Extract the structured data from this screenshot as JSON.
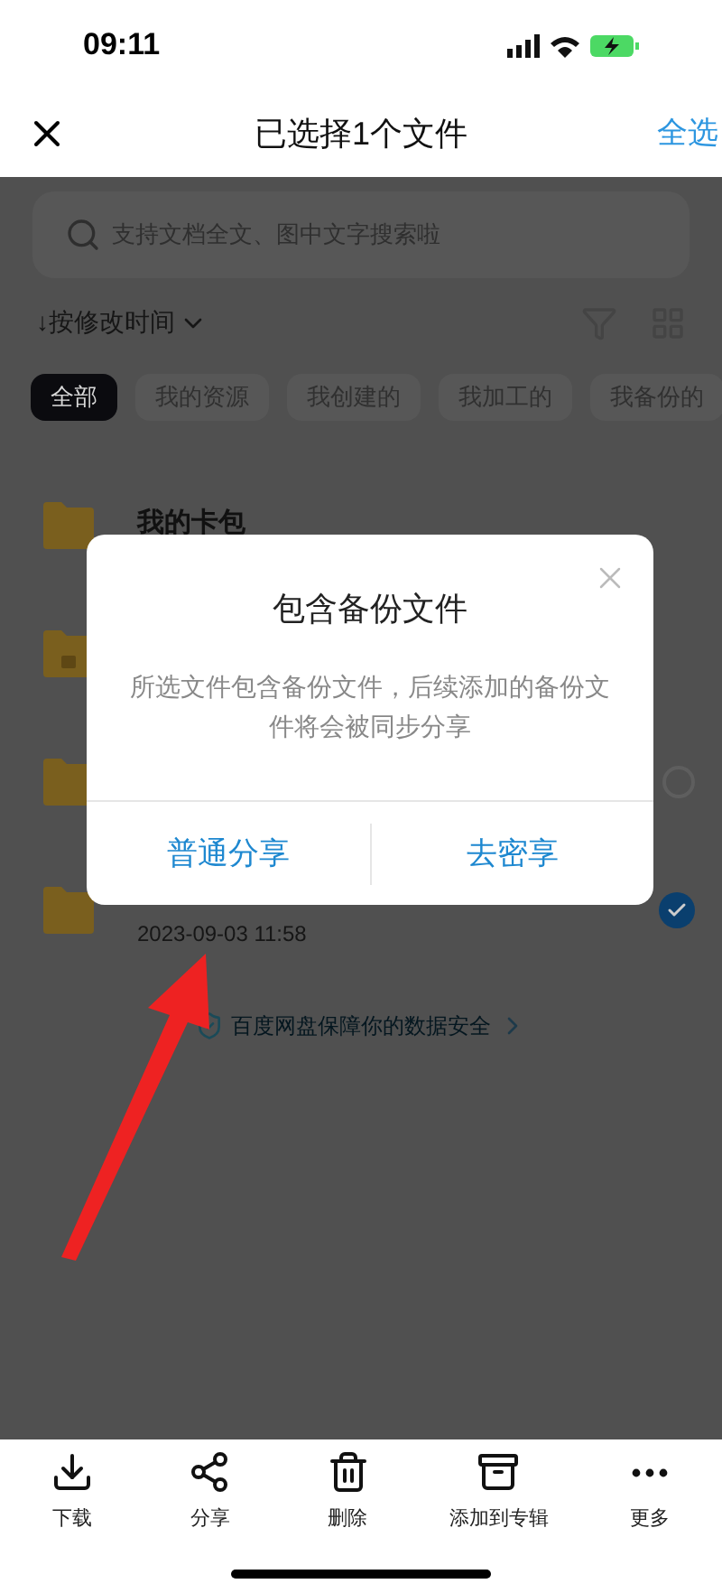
{
  "status_bar": {
    "time": "09:11"
  },
  "header": {
    "title": "已选择1个文件",
    "select_all": "全选"
  },
  "search": {
    "placeholder": "支持文档全文、图中文字搜索啦"
  },
  "sort": {
    "label": "↓按修改时间"
  },
  "chips": [
    {
      "label": "全部",
      "selected": true
    },
    {
      "label": "我的资源",
      "selected": false
    },
    {
      "label": "我创建的",
      "selected": false
    },
    {
      "label": "我加工的",
      "selected": false
    },
    {
      "label": "我备份的",
      "selected": false
    }
  ],
  "files": [
    {
      "name": "我的卡包",
      "locked": false
    },
    {
      "locked": true
    },
    {
      "locked": false,
      "checked": false
    },
    {
      "locked": false,
      "checked": true,
      "date": "2023-09-03 11:58"
    }
  ],
  "security_note": "百度网盘保障你的数据安全",
  "dialog": {
    "title": "包含备份文件",
    "message": "所选文件包含备份文件，后续添加的备份文件将会被同步分享",
    "buttons": [
      "普通分享",
      "去密享"
    ]
  },
  "toolbar": [
    {
      "kind": "download",
      "label": "下载"
    },
    {
      "kind": "share",
      "label": "分享"
    },
    {
      "kind": "delete",
      "label": "删除"
    },
    {
      "kind": "album",
      "label": "添加到专辑"
    },
    {
      "kind": "more",
      "label": "更多"
    }
  ]
}
